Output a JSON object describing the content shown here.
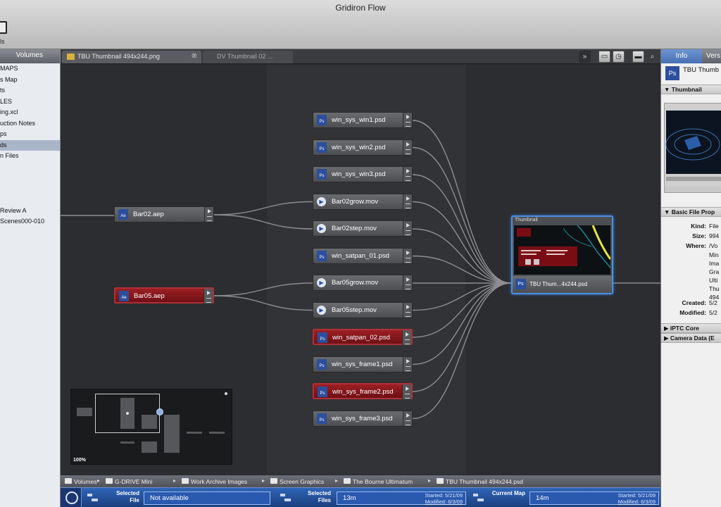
{
  "window": {
    "title": "Gridiron Flow",
    "toolbar_label": "ls"
  },
  "sidebar": {
    "tab": "Volumes",
    "items": [
      "MAPS",
      "s Map",
      "ts",
      "LES",
      "ing.xcl",
      "uction Notes",
      "ps",
      "ds",
      "n Files"
    ],
    "items2": [
      "Review A",
      "Scenes000-010"
    ]
  },
  "tabs": [
    {
      "label": "TBU Thumbnail 494x244.png"
    },
    {
      "label": "DV Thumbnail 02 ..."
    }
  ],
  "nodes": {
    "left": [
      {
        "label": "Bar02.aep",
        "flag": false
      },
      {
        "label": "Bar05.aep",
        "flag": true
      }
    ],
    "middle": [
      {
        "label": "win_sys_win1.psd",
        "kind": "psd",
        "flag": false
      },
      {
        "label": "win_sys_win2.psd",
        "kind": "psd",
        "flag": false
      },
      {
        "label": "win_sys_win3.psd",
        "kind": "psd",
        "flag": false
      },
      {
        "label": "Bar02grow.mov",
        "kind": "mov",
        "flag": false
      },
      {
        "label": "Bar02step.mov",
        "kind": "mov",
        "flag": false
      },
      {
        "label": "win_satpan_01.psd",
        "kind": "psd",
        "flag": false
      },
      {
        "label": "Bar05grow.mov",
        "kind": "mov",
        "flag": false
      },
      {
        "label": "Bar05step.mov",
        "kind": "mov",
        "flag": false
      },
      {
        "label": "win_satpan_02.psd",
        "kind": "psd",
        "flag": true
      },
      {
        "label": "win_sys_frame1.psd",
        "kind": "psd",
        "flag": false
      },
      {
        "label": "win_sys_frame2.psd",
        "kind": "psd",
        "flag": true
      },
      {
        "label": "win_sys_frame3.psd",
        "kind": "psd",
        "flag": false
      }
    ],
    "target": {
      "title": "Thumbnail",
      "label": "TBU Thum...4x244.psd",
      "icon": "Ps"
    },
    "icon_psd": "Ps",
    "icon_aep": "Ae"
  },
  "navigator": {
    "zoom": "100%"
  },
  "breadcrumb": [
    "Volumes",
    "G-DRIVE Mini",
    "Work Archive Images",
    "Screen Graphics",
    "The Bourne Ultimatum",
    "TBU Thumbnail 494x244.psd"
  ],
  "status": {
    "selected_file_label": "Selected File",
    "selected_file_value": "Not available",
    "selected_files_label": "Selected Files",
    "selected_files_value": "13m",
    "selected_files_started": "Started: 5/21/09",
    "selected_files_modified": "Modified: 6/3/09",
    "current_map_label": "Current Map",
    "current_map_value": "14m",
    "current_map_started": "Started: 5/21/09",
    "current_map_modified": "Modified: 6/3/09"
  },
  "inspector": {
    "tabs": [
      "Info",
      "Vers"
    ],
    "file_name": "TBU Thumb",
    "file_icon": "Ps",
    "section_thumbnail": "Thumbnail",
    "section_basic": "Basic File Prop",
    "props": [
      {
        "key": "Kind:",
        "value": "File"
      },
      {
        "key": "Size:",
        "value": "994"
      },
      {
        "key": "Where:",
        "value": "/Vo"
      }
    ],
    "where_lines": [
      "Min",
      "Ima",
      "Gra",
      "Ulti",
      "Thu",
      "494"
    ],
    "props2": [
      {
        "key": "Created:",
        "value": "5/2"
      },
      {
        "key": "Modified:",
        "value": "5/2"
      }
    ],
    "section_iptc": "IPTC Core",
    "section_camera": "Camera Data (E"
  },
  "colors": {
    "accent_blue": "#2f64b6",
    "flag_red": "#9c1f24",
    "selection": "#4a8fe0"
  }
}
